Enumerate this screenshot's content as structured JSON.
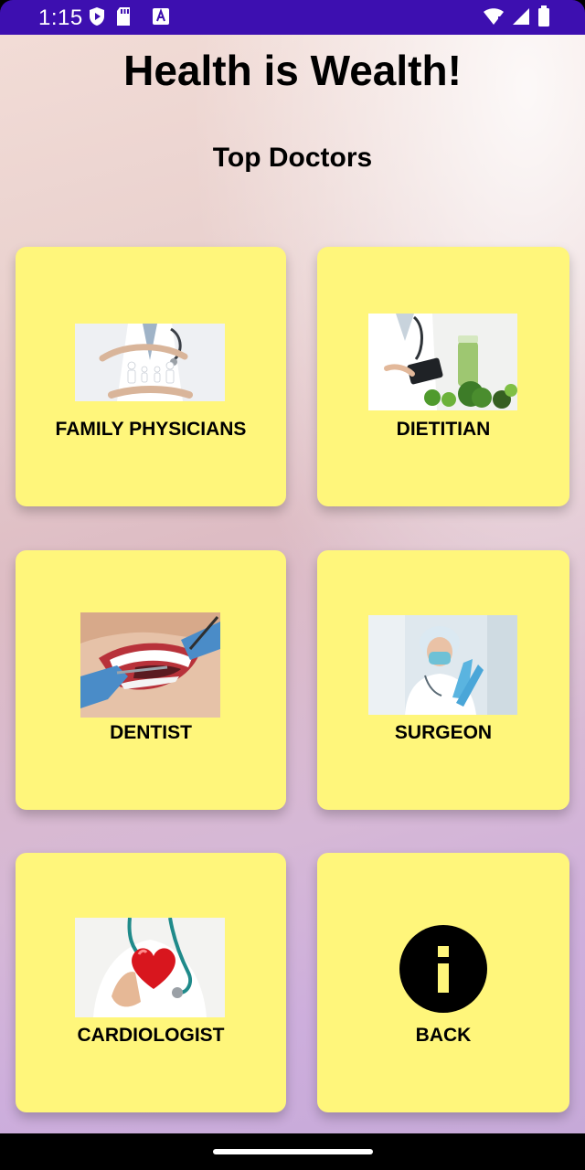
{
  "status_bar": {
    "time": "1:15",
    "icons_left": [
      "play-protect-icon",
      "sd-card-icon",
      "keyboard-a-icon"
    ],
    "icons_right": [
      "wifi-icon",
      "signal-icon",
      "battery-icon"
    ]
  },
  "header": {
    "title": "Health is Wealth!",
    "subtitle": "Top Doctors"
  },
  "cards": [
    {
      "label": "FAMILY PHYSICIANS",
      "icon": "family-care-image"
    },
    {
      "label": "DIETITIAN",
      "icon": "dietitian-image"
    },
    {
      "label": "DENTIST",
      "icon": "dentist-image"
    },
    {
      "label": "SURGEON",
      "icon": "surgeon-image"
    },
    {
      "label": "CARDIOLOGIST",
      "icon": "cardiologist-image"
    },
    {
      "label": "BACK",
      "icon": "info-icon"
    }
  ],
  "colors": {
    "card_background": "#fff67b",
    "status_bar": "#3d0fb0"
  }
}
